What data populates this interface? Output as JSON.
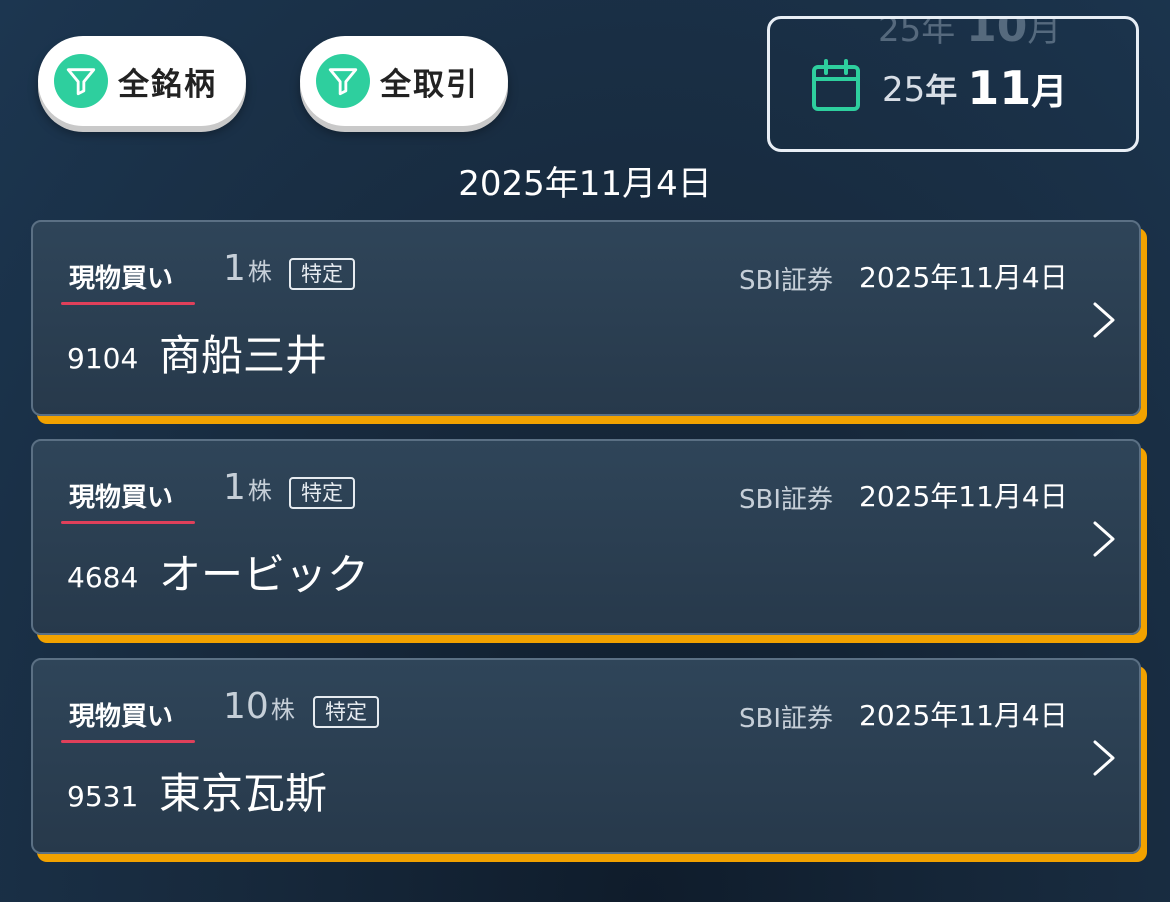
{
  "filters": {
    "stock_label": "全銘柄",
    "trade_label": "全取引"
  },
  "month_picker": {
    "prev_year": "25",
    "prev_year_unit": "年",
    "prev_month": "10",
    "prev_month_unit": "月",
    "year": "25",
    "year_unit": "年",
    "month": "11",
    "month_unit": "月"
  },
  "date_heading": "2025年11月4日",
  "trades": [
    {
      "side": "現物買い",
      "quantity": "1",
      "quantity_unit": "株",
      "account_tag": "特定",
      "broker": "SBI証券",
      "date": "2025年11月4日",
      "code": "9104",
      "name": "商船三井"
    },
    {
      "side": "現物買い",
      "quantity": "1",
      "quantity_unit": "株",
      "account_tag": "特定",
      "broker": "SBI証券",
      "date": "2025年11月4日",
      "code": "4684",
      "name": "オービック"
    },
    {
      "side": "現物買い",
      "quantity": "10",
      "quantity_unit": "株",
      "account_tag": "特定",
      "broker": "SBI証券",
      "date": "2025年11月4日",
      "code": "9531",
      "name": "東京瓦斯"
    }
  ],
  "colors": {
    "accent_green": "#2ecf9e",
    "card_shadow_orange": "#f2a200",
    "buy_underline_red": "#e0405a"
  },
  "icons": {
    "filter": "filter-funnel-icon",
    "calendar": "calendar-icon",
    "chevron": "chevron-right-icon"
  }
}
